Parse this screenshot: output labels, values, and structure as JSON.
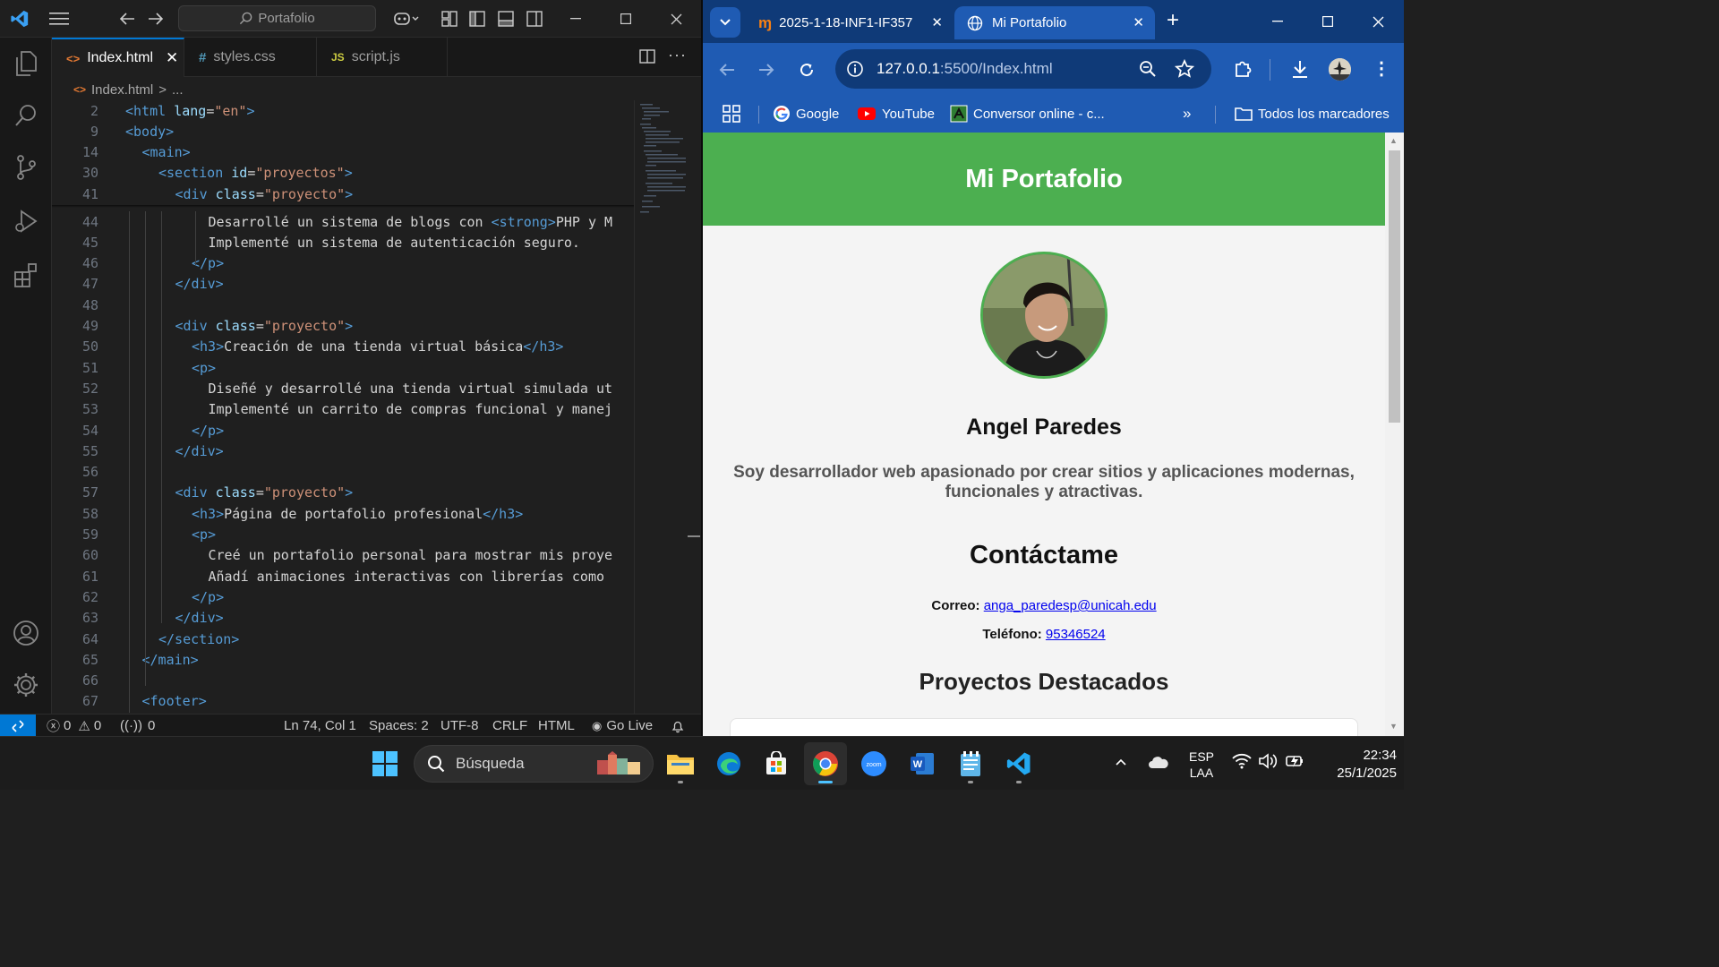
{
  "vscode": {
    "command_center": "Portafolio",
    "tabs": [
      {
        "name": "Index.html",
        "glyph": "<>",
        "glyph_color": "#e37933",
        "active": true
      },
      {
        "name": "styles.css",
        "glyph": "#",
        "glyph_color": "#519aba",
        "active": false
      },
      {
        "name": "script.js",
        "glyph": "JS",
        "glyph_color": "#cbcb41",
        "active": false
      }
    ],
    "breadcrumb": {
      "file": "Index.html",
      "sep": ">",
      "rest": "..."
    },
    "sticky_lines": [
      {
        "n": "2",
        "indent": 0,
        "parts": [
          [
            "tag",
            "<html "
          ],
          [
            "attr",
            "lang"
          ],
          [
            "txt",
            "="
          ],
          [
            "str",
            "\"en\""
          ],
          [
            "tag",
            ">"
          ]
        ]
      },
      {
        "n": "9",
        "indent": 0,
        "parts": [
          [
            "tag",
            "<body>"
          ]
        ]
      },
      {
        "n": "14",
        "indent": 1,
        "parts": [
          [
            "tag",
            "<main>"
          ]
        ]
      },
      {
        "n": "30",
        "indent": 2,
        "parts": [
          [
            "tag",
            "<section "
          ],
          [
            "attr",
            "id"
          ],
          [
            "txt",
            "="
          ],
          [
            "str",
            "\"proyectos\""
          ],
          [
            "tag",
            ">"
          ]
        ]
      },
      {
        "n": "41",
        "indent": 3,
        "parts": [
          [
            "tag",
            "<div "
          ],
          [
            "attr",
            "class"
          ],
          [
            "txt",
            "="
          ],
          [
            "str",
            "\"proyecto\""
          ],
          [
            "tag",
            ">"
          ]
        ]
      }
    ],
    "lines": [
      {
        "n": "44",
        "indent": 5,
        "parts": [
          [
            "txt",
            "Desarrollé un sistema de blogs con "
          ],
          [
            "tag",
            "<strong>"
          ],
          [
            "txt",
            "PHP y M"
          ]
        ]
      },
      {
        "n": "45",
        "indent": 5,
        "parts": [
          [
            "txt",
            "Implementé un sistema de autenticación seguro."
          ]
        ]
      },
      {
        "n": "46",
        "indent": 4,
        "parts": [
          [
            "tag",
            "</p>"
          ]
        ]
      },
      {
        "n": "47",
        "indent": 3,
        "parts": [
          [
            "tag",
            "</div>"
          ]
        ]
      },
      {
        "n": "48",
        "indent": 0,
        "parts": []
      },
      {
        "n": "49",
        "indent": 3,
        "parts": [
          [
            "tag",
            "<div "
          ],
          [
            "attr",
            "class"
          ],
          [
            "txt",
            "="
          ],
          [
            "str",
            "\"proyecto\""
          ],
          [
            "tag",
            ">"
          ]
        ]
      },
      {
        "n": "50",
        "indent": 4,
        "parts": [
          [
            "tag",
            "<h3>"
          ],
          [
            "txt",
            "Creación de una tienda virtual básica"
          ],
          [
            "tag",
            "</h3>"
          ]
        ]
      },
      {
        "n": "51",
        "indent": 4,
        "parts": [
          [
            "tag",
            "<p>"
          ]
        ]
      },
      {
        "n": "52",
        "indent": 5,
        "parts": [
          [
            "txt",
            "Diseñé y desarrollé una tienda virtual simulada ut"
          ]
        ]
      },
      {
        "n": "53",
        "indent": 5,
        "parts": [
          [
            "txt",
            "Implementé un carrito de compras funcional y manej"
          ]
        ]
      },
      {
        "n": "54",
        "indent": 4,
        "parts": [
          [
            "tag",
            "</p>"
          ]
        ]
      },
      {
        "n": "55",
        "indent": 3,
        "parts": [
          [
            "tag",
            "</div>"
          ]
        ]
      },
      {
        "n": "56",
        "indent": 0,
        "parts": []
      },
      {
        "n": "57",
        "indent": 3,
        "parts": [
          [
            "tag",
            "<div "
          ],
          [
            "attr",
            "class"
          ],
          [
            "txt",
            "="
          ],
          [
            "str",
            "\"proyecto\""
          ],
          [
            "tag",
            ">"
          ]
        ]
      },
      {
        "n": "58",
        "indent": 4,
        "parts": [
          [
            "tag",
            "<h3>"
          ],
          [
            "txt",
            "Página de portafolio profesional"
          ],
          [
            "tag",
            "</h3>"
          ]
        ]
      },
      {
        "n": "59",
        "indent": 4,
        "parts": [
          [
            "tag",
            "<p>"
          ]
        ]
      },
      {
        "n": "60",
        "indent": 5,
        "parts": [
          [
            "txt",
            "Creé un portafolio personal para mostrar mis proye"
          ]
        ]
      },
      {
        "n": "61",
        "indent": 5,
        "parts": [
          [
            "txt",
            "Añadí animaciones interactivas con librerías como "
          ]
        ]
      },
      {
        "n": "62",
        "indent": 4,
        "parts": [
          [
            "tag",
            "</p>"
          ]
        ]
      },
      {
        "n": "63",
        "indent": 3,
        "parts": [
          [
            "tag",
            "</div>"
          ]
        ]
      },
      {
        "n": "64",
        "indent": 2,
        "parts": [
          [
            "tag",
            "</section>"
          ]
        ]
      },
      {
        "n": "65",
        "indent": 1,
        "parts": [
          [
            "tag",
            "</main>"
          ]
        ]
      },
      {
        "n": "66",
        "indent": 0,
        "parts": []
      },
      {
        "n": "67",
        "indent": 1,
        "parts": [
          [
            "tag",
            "<footer>"
          ]
        ]
      }
    ],
    "status": {
      "errors": "0",
      "warnings": "0",
      "ports": "0",
      "position": "Ln 74, Col 1",
      "spaces": "Spaces: 2",
      "encoding": "UTF-8",
      "eol": "CRLF",
      "language": "HTML",
      "golive": "Go Live"
    },
    "colors": {
      "accent": "#0078d4",
      "tag": "#569cd6",
      "attr": "#9cdcfe",
      "string": "#ce9178",
      "text": "#d4d4d4"
    }
  },
  "chrome": {
    "tabs": [
      {
        "title": "2025-1-18-INF1-IF357",
        "icon": "moodle-icon",
        "active": false
      },
      {
        "title": "Mi Portafolio",
        "icon": "globe-icon",
        "active": true
      }
    ],
    "url_host": "127.0.0.1",
    "url_path": ":5500/Index.html",
    "bookmarks": [
      {
        "label": "Google",
        "icon": "google-icon"
      },
      {
        "label": "YouTube",
        "icon": "youtube-icon"
      },
      {
        "label": "Conversor online - c...",
        "icon": "converter-icon"
      }
    ],
    "all_bookmarks": "Todos los marcadores",
    "page": {
      "header_title": "Mi Portafolio",
      "name": "Angel Paredes",
      "bio": "Soy desarrollador web apasionado por crear sitios y aplicaciones modernas, funcionales y atractivas.",
      "contact_title": "Contáctame",
      "email_label": "Correo:",
      "email": "anga_paredesp@unicah.edu",
      "phone_label": "Teléfono:",
      "phone": "95346524",
      "projects_title": "Proyectos Destacados",
      "header_color": "#4caf50"
    }
  },
  "taskbar": {
    "search_placeholder": "Búsqueda",
    "lang_top": "ESP",
    "lang_bottom": "LAA",
    "time": "22:34",
    "date": "25/1/2025"
  }
}
